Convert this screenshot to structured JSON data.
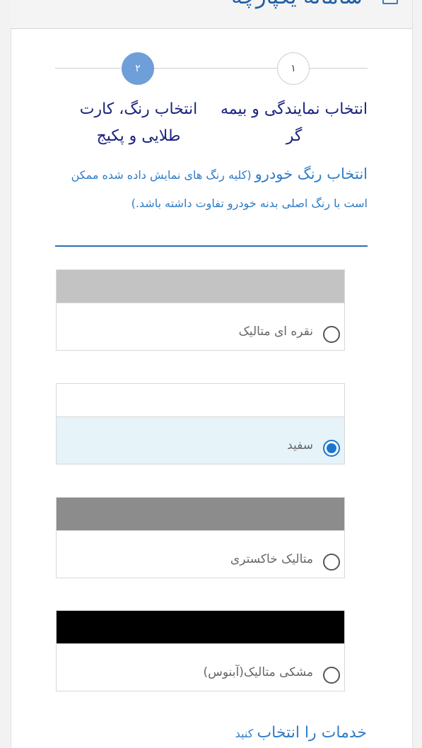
{
  "header": {
    "title": "سامانه یکپارچه",
    "icon": "window-icon"
  },
  "steps": [
    {
      "number": "۱",
      "label": "انتخاب نمایندگی و بیمه گر",
      "active": false
    },
    {
      "number": "۲",
      "label": "انتخاب رنگ، کارت طلایی و پکیج",
      "active": true
    }
  ],
  "color_section": {
    "heading": "انتخاب رنگ خودرو",
    "note": "(کلیه رنگ های نمایش داده شده ممکن است با رنگ اصلی بدنه خودرو تفاوت داشته باشد.)"
  },
  "colors": [
    {
      "label": "نقره ای متالیک",
      "swatch": "#c3c3c3",
      "selected": false
    },
    {
      "label": "سفید",
      "swatch": "#ffffff",
      "selected": true
    },
    {
      "label": "متالیک خاکستری",
      "swatch": "#8c8c8c",
      "selected": false
    },
    {
      "label": "مشکی متالیک(آبنوس)",
      "swatch": "#000000",
      "selected": false
    }
  ],
  "services": {
    "heading": "خدمات را انتخاب",
    "suffix": "کنید"
  }
}
